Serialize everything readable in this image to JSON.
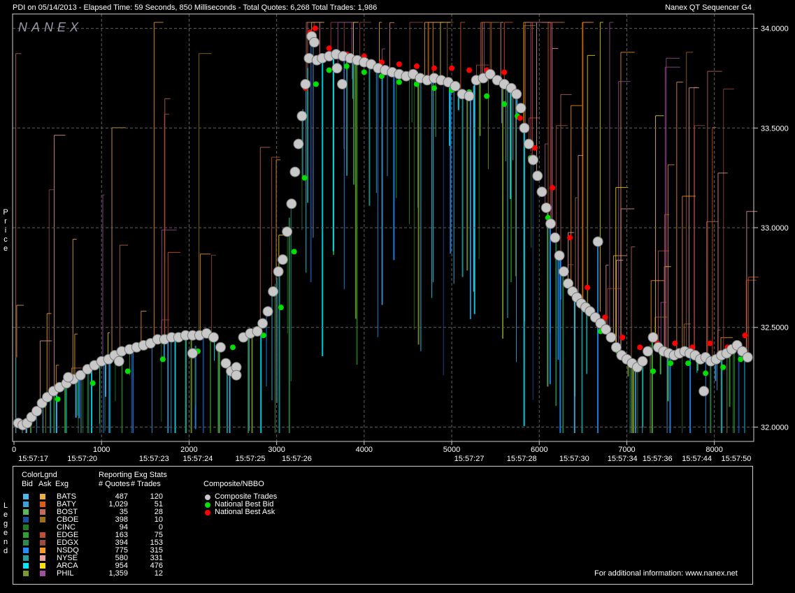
{
  "header": {
    "title_left": "PDI on 05/14/2013  -  Elapsed Time: 59 Seconds, 850 Milliseconds  -  Total Quotes: 6,268  Total Trades: 1,986",
    "title_right": "Nanex QT Sequencer G4",
    "watermark": "NANEX"
  },
  "side_labels": {
    "price": "Price",
    "legend": "Legend"
  },
  "legend": {
    "color_legend_title": "ColorLgnd",
    "stats_title": "Reporting Exg Stats",
    "col_bid": "Bid",
    "col_ask": "Ask",
    "col_exg": "Exg",
    "col_quotes": "# Quotes",
    "col_trades": "# Trades",
    "composite_title": "Composite/NBBO",
    "composite_items": [
      {
        "label": "Composite Trades",
        "color": "#c8c8c8"
      },
      {
        "label": "National Best Bid",
        "color": "#00e000"
      },
      {
        "label": "National Best Ask",
        "color": "#ff0000"
      }
    ],
    "exchanges": [
      {
        "exg": "BATS",
        "quotes": "487",
        "trades": "120",
        "bid_color": "#4fb8e8",
        "ask_color": "#f0b040"
      },
      {
        "exg": "BATY",
        "quotes": "1,029",
        "trades": "51",
        "bid_color": "#3aa0e0",
        "ask_color": "#e05a10"
      },
      {
        "exg": "BOST",
        "quotes": "35",
        "trades": "28",
        "bid_color": "#5ab85a",
        "ask_color": "#c86a5a"
      },
      {
        "exg": "CBOE",
        "quotes": "398",
        "trades": "10",
        "bid_color": "#1a4fa0",
        "ask_color": "#a07010"
      },
      {
        "exg": "CINC",
        "quotes": "94",
        "trades": "0",
        "bid_color": "#207a20",
        "ask_color": "#000000"
      },
      {
        "exg": "EDGE",
        "quotes": "163",
        "trades": "75",
        "bid_color": "#30a030",
        "ask_color": "#c05030"
      },
      {
        "exg": "EDGX",
        "quotes": "394",
        "trades": "153",
        "bid_color": "#2c8a4a",
        "ask_color": "#a04a3a"
      },
      {
        "exg": "NSDQ",
        "quotes": "775",
        "trades": "315",
        "bid_color": "#1e90ff",
        "ask_color": "#ff9a20"
      },
      {
        "exg": "NYSE",
        "quotes": "580",
        "trades": "331",
        "bid_color": "#20a0a0",
        "ask_color": "#f0a0a0"
      },
      {
        "exg": "ARCA",
        "quotes": "954",
        "trades": "476",
        "bid_color": "#00e8ff",
        "ask_color": "#ffe000"
      },
      {
        "exg": "PHIL",
        "quotes": "1,359",
        "trades": "12",
        "bid_color": "#7a9a2a",
        "ask_color": "#a050a0"
      }
    ]
  },
  "footer": {
    "info": "For additional information: www.nanex.net"
  },
  "chart_data": {
    "type": "scatter",
    "title": "PDI on 05/14/2013",
    "xlabel": "",
    "ylabel": "Price",
    "xlim": [
      0,
      8450
    ],
    "ylim": [
      31.97,
      34.03
    ],
    "grid": true,
    "y_ticks": [
      "32.0000",
      "32.5000",
      "33.0000",
      "33.5000",
      "34.0000"
    ],
    "y_tick_values": [
      32.0,
      32.5,
      33.0,
      33.5,
      34.0
    ],
    "x_ticks": [
      0,
      1000,
      2000,
      3000,
      4000,
      5000,
      6000,
      7000,
      8000
    ],
    "time_labels": [
      {
        "x": 220,
        "label": "15:57:17"
      },
      {
        "x": 780,
        "label": "15:57:20"
      },
      {
        "x": 1600,
        "label": "15:57:23"
      },
      {
        "x": 2100,
        "label": "15:57:24"
      },
      {
        "x": 2700,
        "label": "15:57:25"
      },
      {
        "x": 3230,
        "label": "15:57:26"
      },
      {
        "x": 5200,
        "label": "15:57:27"
      },
      {
        "x": 5800,
        "label": "15:57:28"
      },
      {
        "x": 6400,
        "label": "15:57:30"
      },
      {
        "x": 6950,
        "label": "15:57:34"
      },
      {
        "x": 7350,
        "label": "15:57:36"
      },
      {
        "x": 7800,
        "label": "15:57:44"
      },
      {
        "x": 8250,
        "label": "15:57:50"
      }
    ],
    "composite_trades": [
      [
        50,
        32.02
      ],
      [
        100,
        32.01
      ],
      [
        150,
        32.02
      ],
      [
        200,
        32.05
      ],
      [
        260,
        32.08
      ],
      [
        320,
        32.12
      ],
      [
        380,
        32.15
      ],
      [
        450,
        32.18
      ],
      [
        520,
        32.2
      ],
      [
        600,
        32.22
      ],
      [
        680,
        32.24
      ],
      [
        760,
        32.26
      ],
      [
        840,
        32.29
      ],
      [
        920,
        32.31
      ],
      [
        1000,
        32.33
      ],
      [
        1080,
        32.34
      ],
      [
        1150,
        32.36
      ],
      [
        1230,
        32.38
      ],
      [
        1320,
        32.39
      ],
      [
        1400,
        32.4
      ],
      [
        1480,
        32.41
      ],
      [
        1560,
        32.42
      ],
      [
        1640,
        32.44
      ],
      [
        1720,
        32.44
      ],
      [
        1800,
        32.45
      ],
      [
        1880,
        32.45
      ],
      [
        1960,
        32.46
      ],
      [
        2040,
        32.46
      ],
      [
        2120,
        32.46
      ],
      [
        2200,
        32.47
      ],
      [
        2280,
        32.45
      ],
      [
        2360,
        32.4
      ],
      [
        2420,
        32.32
      ],
      [
        2480,
        32.28
      ],
      [
        2540,
        32.3
      ],
      [
        2620,
        32.45
      ],
      [
        2700,
        32.47
      ],
      [
        2780,
        32.48
      ],
      [
        2840,
        32.52
      ],
      [
        2900,
        32.58
      ],
      [
        2960,
        32.68
      ],
      [
        3020,
        32.78
      ],
      [
        3070,
        32.84
      ],
      [
        3120,
        32.98
      ],
      [
        3170,
        33.12
      ],
      [
        3210,
        33.28
      ],
      [
        3250,
        33.42
      ],
      [
        3290,
        33.56
      ],
      [
        3330,
        33.72
      ],
      [
        3370,
        33.85
      ],
      [
        3400,
        33.96
      ],
      [
        3430,
        33.93
      ],
      [
        3460,
        33.84
      ],
      [
        3520,
        33.85
      ],
      [
        3600,
        33.86
      ],
      [
        3680,
        33.87
      ],
      [
        3760,
        33.86
      ],
      [
        3840,
        33.85
      ],
      [
        3920,
        33.84
      ],
      [
        4000,
        33.83
      ],
      [
        4080,
        33.82
      ],
      [
        4160,
        33.8
      ],
      [
        4240,
        33.79
      ],
      [
        4320,
        33.78
      ],
      [
        4400,
        33.77
      ],
      [
        4480,
        33.76
      ],
      [
        4560,
        33.77
      ],
      [
        4640,
        33.75
      ],
      [
        4720,
        33.74
      ],
      [
        4800,
        33.75
      ],
      [
        4880,
        33.74
      ],
      [
        4960,
        33.73
      ],
      [
        5040,
        33.71
      ],
      [
        5120,
        33.67
      ],
      [
        5200,
        33.66
      ],
      [
        5280,
        33.74
      ],
      [
        5360,
        33.75
      ],
      [
        5440,
        33.77
      ],
      [
        5520,
        33.74
      ],
      [
        5600,
        33.72
      ],
      [
        5680,
        33.7
      ],
      [
        5740,
        33.67
      ],
      [
        5790,
        33.6
      ],
      [
        5830,
        33.5
      ],
      [
        5880,
        33.42
      ],
      [
        5930,
        33.34
      ],
      [
        5980,
        33.26
      ],
      [
        6030,
        33.18
      ],
      [
        6080,
        33.1
      ],
      [
        6130,
        33.02
      ],
      [
        6180,
        32.95
      ],
      [
        6230,
        32.86
      ],
      [
        6280,
        32.78
      ],
      [
        6330,
        32.72
      ],
      [
        6380,
        32.68
      ],
      [
        6430,
        32.65
      ],
      [
        6480,
        32.62
      ],
      [
        6530,
        32.6
      ],
      [
        6580,
        32.58
      ],
      [
        6640,
        32.55
      ],
      [
        6700,
        32.52
      ],
      [
        6760,
        32.49
      ],
      [
        6820,
        32.45
      ],
      [
        6880,
        32.4
      ],
      [
        6940,
        32.36
      ],
      [
        7000,
        32.34
      ],
      [
        7060,
        32.32
      ],
      [
        7120,
        32.3
      ],
      [
        7180,
        32.33
      ],
      [
        7240,
        32.38
      ],
      [
        7300,
        32.45
      ],
      [
        7360,
        32.4
      ],
      [
        7420,
        32.38
      ],
      [
        7480,
        32.37
      ],
      [
        7540,
        32.36
      ],
      [
        7600,
        32.37
      ],
      [
        7660,
        32.38
      ],
      [
        7720,
        32.37
      ],
      [
        7780,
        32.36
      ],
      [
        7840,
        32.34
      ],
      [
        7900,
        32.35
      ],
      [
        7960,
        32.33
      ],
      [
        8020,
        32.34
      ],
      [
        8080,
        32.36
      ],
      [
        8140,
        32.37
      ],
      [
        8200,
        32.39
      ],
      [
        8260,
        32.41
      ],
      [
        8320,
        32.38
      ],
      [
        8380,
        32.35
      ],
      [
        6670,
        32.93
      ],
      [
        2040,
        32.37
      ],
      [
        2540,
        32.26
      ],
      [
        7880,
        32.18
      ],
      [
        1200,
        32.33
      ],
      [
        620,
        32.25
      ],
      [
        3750,
        33.72
      ],
      [
        3690,
        33.8
      ]
    ],
    "nbb": [
      [
        200,
        32.06
      ],
      [
        500,
        32.14
      ],
      [
        900,
        32.22
      ],
      [
        1300,
        32.28
      ],
      [
        1700,
        32.34
      ],
      [
        2100,
        32.38
      ],
      [
        2500,
        32.4
      ],
      [
        2850,
        32.46
      ],
      [
        3050,
        32.6
      ],
      [
        3200,
        32.88
      ],
      [
        3320,
        33.25
      ],
      [
        3450,
        33.72
      ],
      [
        3600,
        33.79
      ],
      [
        3800,
        33.81
      ],
      [
        4000,
        33.78
      ],
      [
        4200,
        33.76
      ],
      [
        4400,
        33.73
      ],
      [
        4600,
        33.72
      ],
      [
        4800,
        33.7
      ],
      [
        5000,
        33.69
      ],
      [
        5200,
        33.68
      ],
      [
        5400,
        33.66
      ],
      [
        5600,
        33.62
      ],
      [
        5750,
        33.56
      ],
      [
        5900,
        33.35
      ],
      [
        6100,
        33.05
      ],
      [
        6300,
        32.72
      ],
      [
        6500,
        32.6
      ],
      [
        6700,
        32.48
      ],
      [
        6900,
        32.38
      ],
      [
        7100,
        32.3
      ],
      [
        7300,
        32.28
      ],
      [
        7500,
        32.32
      ],
      [
        7700,
        32.32
      ],
      [
        7900,
        32.27
      ],
      [
        8100,
        32.3
      ],
      [
        8300,
        32.34
      ]
    ],
    "nbo": [
      [
        3330,
        33.7
      ],
      [
        3380,
        33.98
      ],
      [
        3440,
        34.0
      ],
      [
        3600,
        33.9
      ],
      [
        3800,
        33.87
      ],
      [
        4000,
        33.86
      ],
      [
        4200,
        33.83
      ],
      [
        4400,
        33.82
      ],
      [
        4600,
        33.81
      ],
      [
        4800,
        33.8
      ],
      [
        5000,
        33.8
      ],
      [
        5200,
        33.79
      ],
      [
        5400,
        33.79
      ],
      [
        5600,
        33.78
      ],
      [
        5780,
        33.55
      ],
      [
        5950,
        33.4
      ],
      [
        6150,
        33.2
      ],
      [
        6350,
        32.95
      ],
      [
        6550,
        32.7
      ],
      [
        6750,
        32.55
      ],
      [
        6950,
        32.45
      ],
      [
        7150,
        32.4
      ],
      [
        7350,
        32.42
      ],
      [
        7550,
        32.42
      ],
      [
        7750,
        32.4
      ],
      [
        7950,
        32.42
      ],
      [
        8150,
        32.4
      ],
      [
        8350,
        32.46
      ]
    ]
  }
}
